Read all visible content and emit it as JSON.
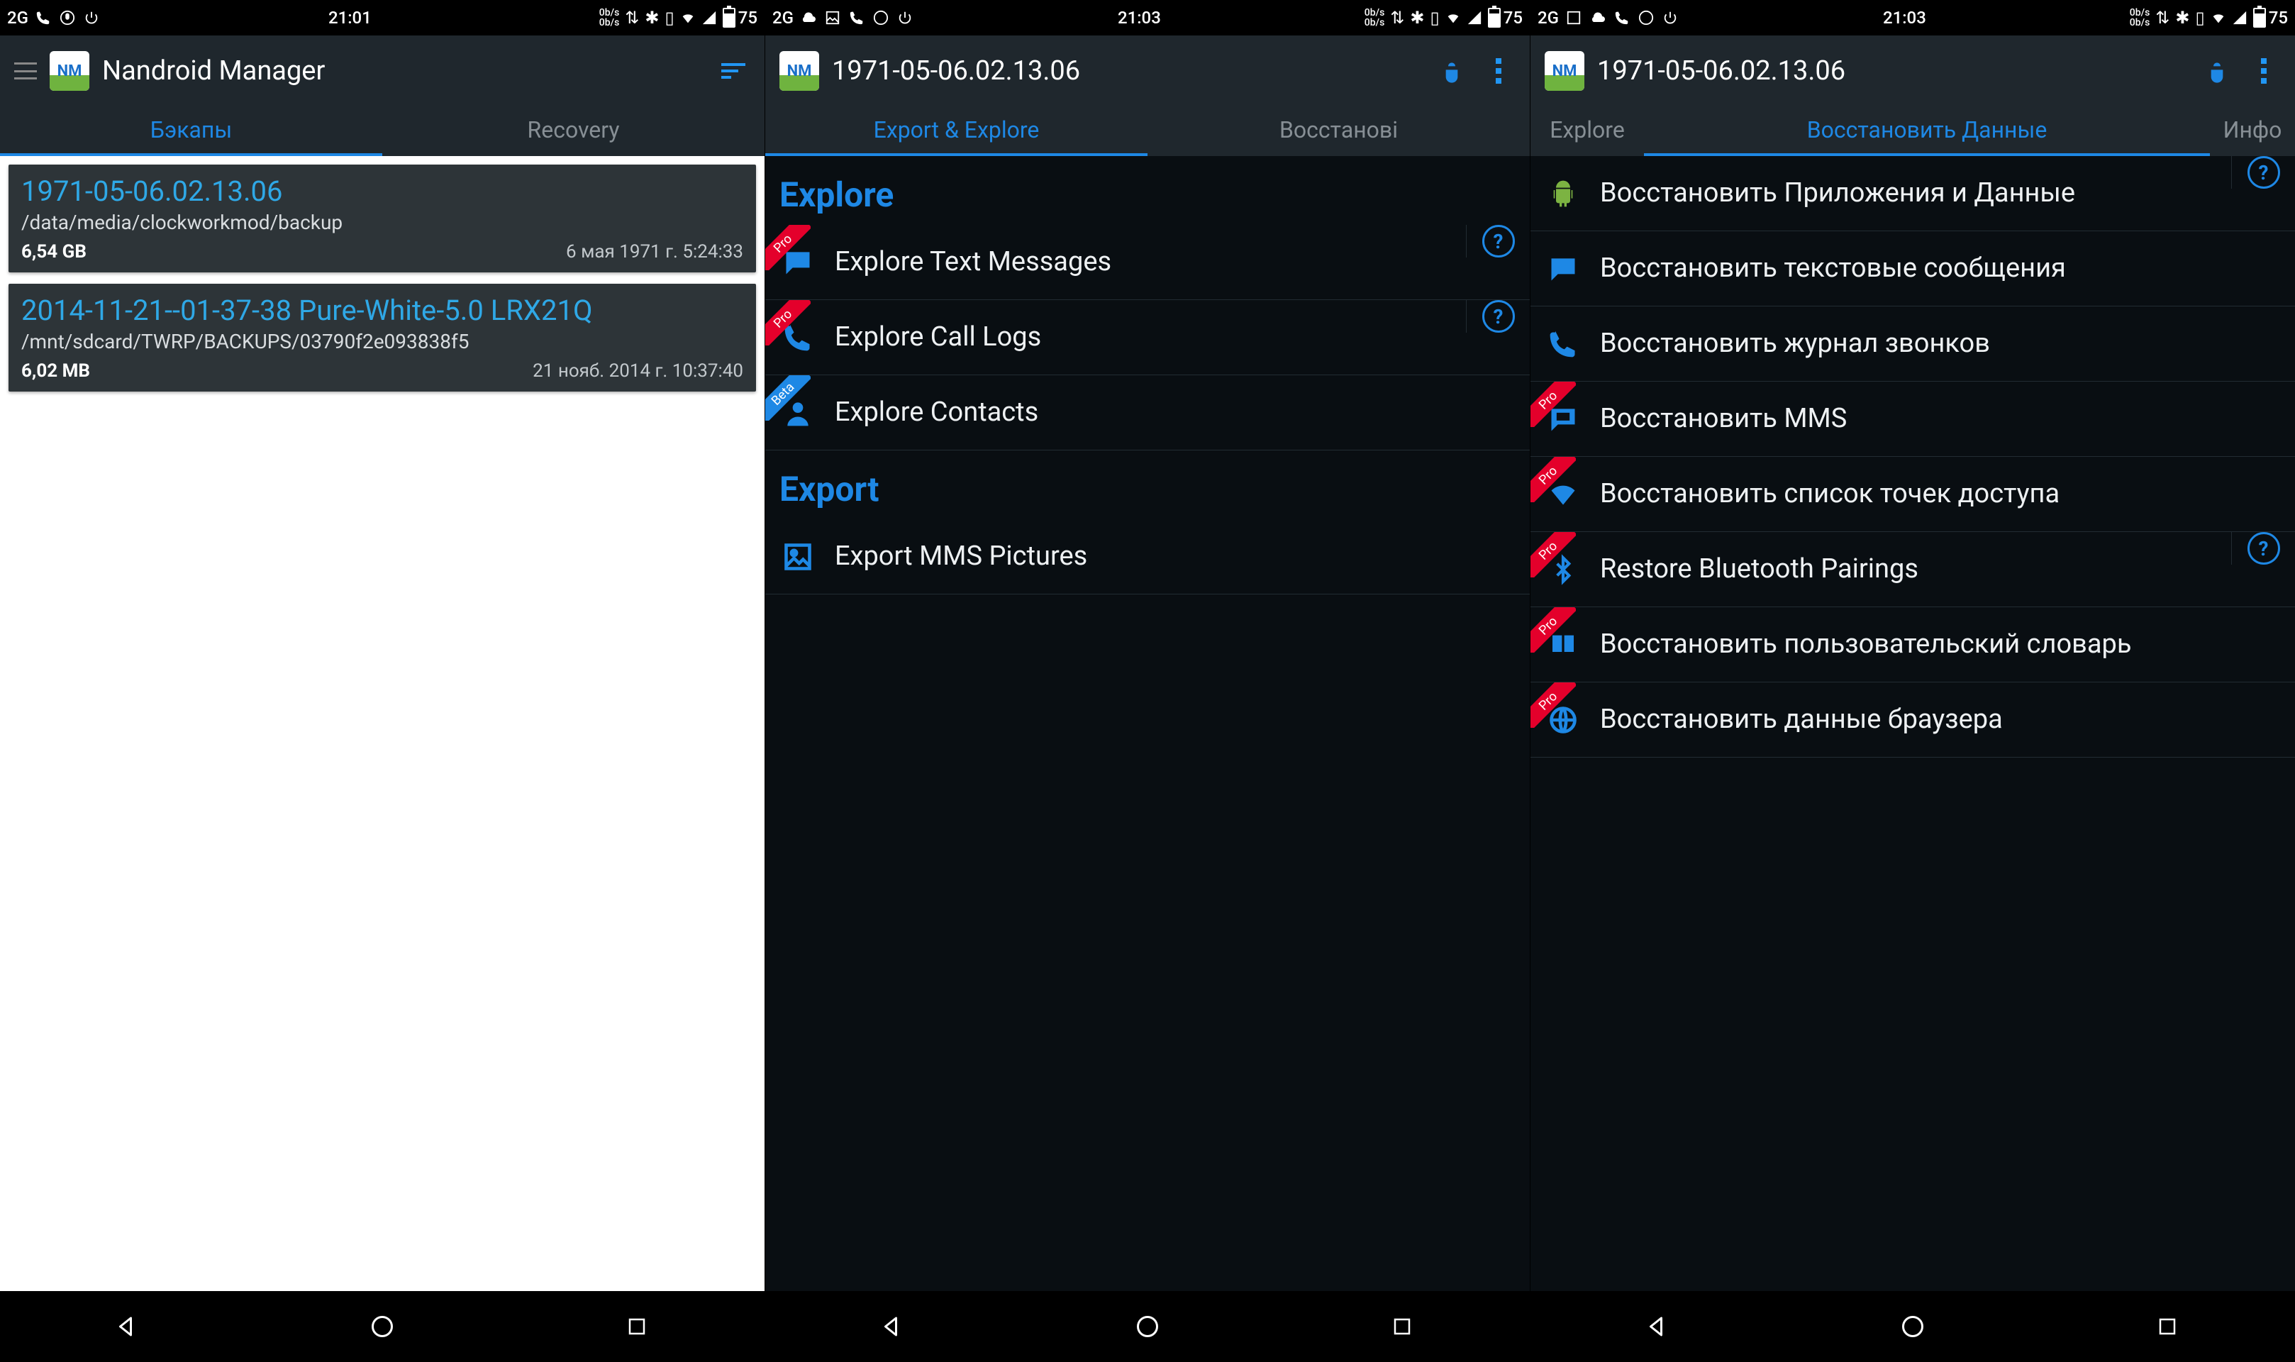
{
  "status": {
    "net": "2G",
    "time1": "21:01",
    "time2": "21:03",
    "time3": "21:03",
    "speed": "0b/s",
    "battery": "75"
  },
  "s1": {
    "appTitle": "Nandroid Manager",
    "tabs": [
      "Бэкапы",
      "Recovery"
    ],
    "activeTab": 0,
    "backups": [
      {
        "name": "1971-05-06.02.13.06",
        "path": "/data/media/clockworkmod/backup",
        "size": "6,54 GB",
        "date": "6 мая 1971 г. 5:24:33"
      },
      {
        "name": "2014-11-21--01-37-38 Pure-White-5.0 LRX21Q",
        "path": "/mnt/sdcard/TWRP/BACKUPS/03790f2e093838f5",
        "size": "6,02 MB",
        "date": "21 нояб. 2014 г. 10:37:40"
      }
    ]
  },
  "s2": {
    "appTitle": "1971-05-06.02.13.06",
    "tabs": [
      "Export & Explore",
      "Восстанові"
    ],
    "activeTab": 0,
    "exploreHdr": "Explore",
    "exportHdr": "Export",
    "explore": [
      {
        "label": "Explore Text Messages",
        "ribbon": "Pro",
        "help": true,
        "icon": "msg"
      },
      {
        "label": "Explore Call Logs",
        "ribbon": "Pro",
        "help": true,
        "icon": "phone"
      },
      {
        "label": "Explore Contacts",
        "ribbon": "Beta",
        "help": false,
        "icon": "contact"
      }
    ],
    "export": [
      {
        "label": "Export MMS Pictures",
        "ribbon": "",
        "help": false,
        "icon": "image"
      }
    ]
  },
  "s3": {
    "appTitle": "1971-05-06.02.13.06",
    "tabs": [
      "Explore",
      "Восстановить Данные",
      "Инфо"
    ],
    "activeTab": 1,
    "items": [
      {
        "label": "Восстановить Приложения и Данные",
        "ribbon": "",
        "help": true,
        "icon": "android"
      },
      {
        "label": "Восстановить текстовые сообщения",
        "ribbon": "",
        "help": false,
        "icon": "msg"
      },
      {
        "label": "Восстановить журнал звонков",
        "ribbon": "",
        "help": false,
        "icon": "phone"
      },
      {
        "label": "Восстановить MMS",
        "ribbon": "Pro",
        "help": false,
        "icon": "mms"
      },
      {
        "label": "Восстановить список точек доступа",
        "ribbon": "Pro",
        "help": false,
        "icon": "wifi"
      },
      {
        "label": "Restore Bluetooth Pairings",
        "ribbon": "Pro",
        "help": true,
        "icon": "bt"
      },
      {
        "label": "Восстановить пользовательский словарь",
        "ribbon": "Pro",
        "help": false,
        "icon": "book"
      },
      {
        "label": "Восстановить данные браузера",
        "ribbon": "Pro",
        "help": false,
        "icon": "globe"
      }
    ]
  },
  "ribbonText": {
    "Pro": "Pro",
    "Beta": "Beta"
  }
}
